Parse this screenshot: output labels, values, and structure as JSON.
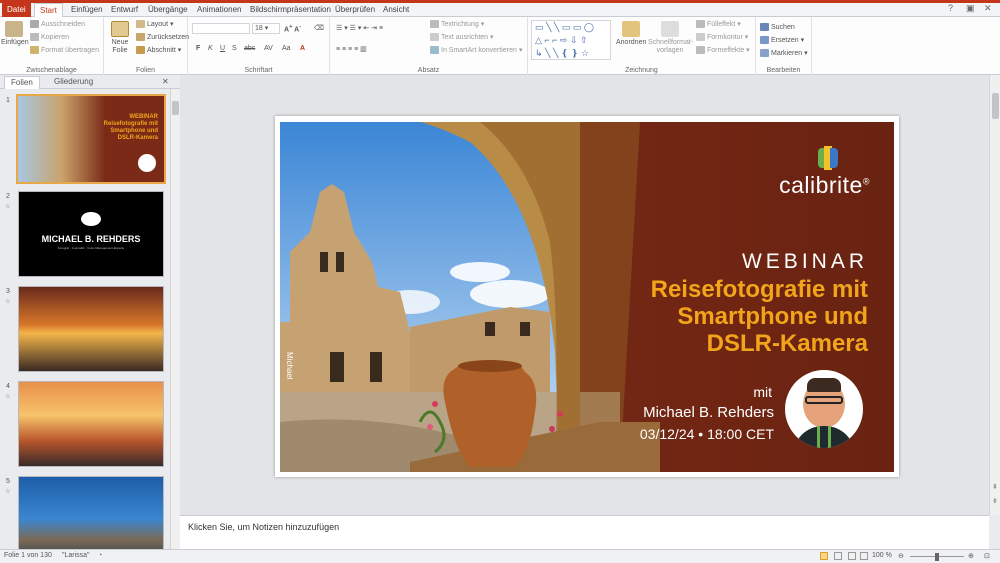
{
  "app": {
    "tabs": [
      "Datei",
      "Start",
      "Einfügen",
      "Entwurf",
      "Übergänge",
      "Animationen",
      "Bildschirmpräsentation",
      "Überprüfen",
      "Ansicht"
    ],
    "active_tab": "Start",
    "window_controls": [
      "?",
      "▣",
      "—",
      "✕"
    ]
  },
  "ribbon": {
    "clipboard": {
      "paste_label": "Einfügen",
      "cut_label": "Ausschneiden",
      "copy_label": "Kopieren",
      "format_painter_label": "Format übertragen",
      "group_label": "Zwischenablage"
    },
    "slides": {
      "new_slide_label": "Neue Folie",
      "layout_label": "Layout",
      "reset_label": "Zurücksetzen",
      "section_label": "Abschnitt",
      "group_label": "Folien"
    },
    "font": {
      "font_size": "18",
      "buttons": [
        "F",
        "K",
        "U",
        "S",
        "abc",
        "AV",
        "Aa",
        "A"
      ],
      "group_label": "Schriftart"
    },
    "paragraph": {
      "text_direction_label": "Textrichtung",
      "align_text_label": "Text ausrichten",
      "smartart_label": "In SmartArt konvertieren",
      "group_label": "Absatz"
    },
    "drawing": {
      "arrange_label": "Anordnen",
      "quick_styles_label": "Schnellformat-vorlagen",
      "fill_label": "Fülleffekt",
      "outline_label": "Formkontur",
      "effects_label": "Formeffekte",
      "group_label": "Zeichnung"
    },
    "editing": {
      "find_label": "Suchen",
      "replace_label": "Ersetzen",
      "select_label": "Markieren",
      "group_label": "Bearbeiten"
    }
  },
  "left_panel": {
    "tabs": [
      "Folien",
      "Gliederung"
    ],
    "close": "✕",
    "slides": [
      {
        "number": "1",
        "selected": true
      },
      {
        "number": "2",
        "text": "MICHAEL B. REHDERS",
        "subtext": "Fotograf · Journalist · Color-Management-Experte"
      },
      {
        "number": "3"
      },
      {
        "number": "4"
      },
      {
        "number": "5"
      }
    ]
  },
  "slide": {
    "logo_text": "calibrite",
    "logo_mark": "®",
    "eyebrow": "WEBINAR",
    "title_lines": [
      "Reisefotografie mit",
      "Smartphone und",
      "DSLR-Kamera"
    ],
    "with_label": "mit",
    "presenter": "Michael B. Rehders",
    "date_time": "03/12/24 • 18:00 CET",
    "photo_credit": "Michael"
  },
  "notes": {
    "placeholder": "Klicken Sie, um Notizen hinzuzufügen"
  },
  "status": {
    "slide_counter": "Folie 1 von 130",
    "theme": "\"Larissa\"",
    "zoom": "100 %"
  },
  "colors": {
    "accent": "#c4351b",
    "title_gold": "#f2a51a",
    "slide_bg": "#7a2a17"
  }
}
